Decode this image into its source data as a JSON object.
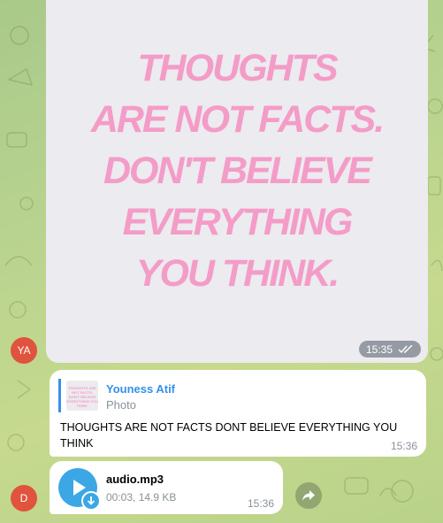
{
  "photo_message": {
    "quote_lines": [
      "THOUGHTS",
      "ARE NOT FACTS.",
      "DON'T BELIEVE",
      "EVERYTHING",
      "YOU THINK."
    ],
    "time": "15:35",
    "status_icon": "double-check-icon"
  },
  "avatar_top": {
    "initials": "YA",
    "color": "#e0533d"
  },
  "avatar_bottom": {
    "initials": "D",
    "color": "#e0533d"
  },
  "reply_message": {
    "quoted_author": "Youness Atif",
    "quoted_type": "Photo",
    "thumbnail_text": "THOUGHTS ARE NOT FACTS. DON'T BELIEVE EVERYTHING YOU THINK.",
    "text": "THOUGHTS ARE NOT FACTS DONT BELIEVE EVERYTHING YOU THINK",
    "time": "15:36"
  },
  "audio_message": {
    "file_name": "audio.mp3",
    "meta": "00:03, 14.9 KB",
    "time": "15:36"
  },
  "forward_button": {
    "icon": "forward-arrow-icon"
  },
  "colors": {
    "accent": "#3390ec",
    "quote_pink": "#f49cc8",
    "avatar": "#e0533d",
    "play": "#3ca7e5"
  }
}
